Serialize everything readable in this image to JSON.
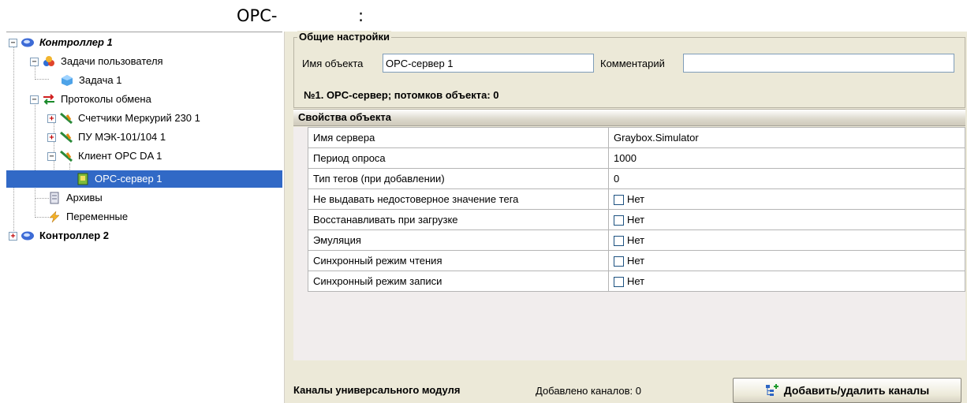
{
  "caption": {
    "left": "OPC-",
    "right": ":"
  },
  "tree": {
    "items": [
      {
        "label": "Контроллер 1",
        "icon": "controller-icon",
        "expander": "⊟"
      },
      {
        "label": "Задачи пользователя",
        "icon": "tasks-icon",
        "expander": "⊟"
      },
      {
        "label": "Задача 1",
        "icon": "cube-icon"
      },
      {
        "label": "Протоколы обмена",
        "icon": "protocols-icon",
        "expander": "⊟"
      },
      {
        "label": "Счетчики Меркурий 230 1",
        "icon": "plug-icon",
        "expander": "+"
      },
      {
        "label": "ПУ МЭК-101/104 1",
        "icon": "plug-icon",
        "expander": "+"
      },
      {
        "label": "Клиент OPC DA 1",
        "icon": "plug-icon",
        "expander": "−"
      },
      {
        "label": "OPC-сервер 1",
        "icon": "opc-server-icon"
      },
      {
        "label": "Архивы",
        "icon": "archive-icon"
      },
      {
        "label": "Переменные",
        "icon": "lightning-icon"
      },
      {
        "label": "Контроллер 2",
        "icon": "controller-icon",
        "expander": "+"
      }
    ]
  },
  "general": {
    "title": "Общие настройки",
    "name_label": "Имя объекта",
    "name_value": "OPC-сервер 1",
    "comment_label": "Комментарий",
    "comment_value": "",
    "info": "№1. OPC-сервер; потомков объекта: 0"
  },
  "properties": {
    "title": "Свойства объекта",
    "rows": [
      {
        "key": "Имя сервера",
        "value": "Graybox.Simulator"
      },
      {
        "key": "Период опроса",
        "value": "1000"
      },
      {
        "key": "Тип тегов (при добавлении)",
        "value": "0"
      },
      {
        "key": "Не выдавать недостоверное значение тега",
        "value": "Нет"
      },
      {
        "key": "Восстанавливать при загрузке",
        "value": "Нет"
      },
      {
        "key": "Эмуляция",
        "value": "Нет"
      },
      {
        "key": "Синхронный режим чтения",
        "value": "Нет"
      },
      {
        "key": "Синхронный режим записи",
        "value": "Нет"
      }
    ]
  },
  "footer": {
    "title": "Каналы универсального модуля",
    "count": "Добавлено каналов: 0",
    "button": "Добавить/удалить каналы"
  }
}
